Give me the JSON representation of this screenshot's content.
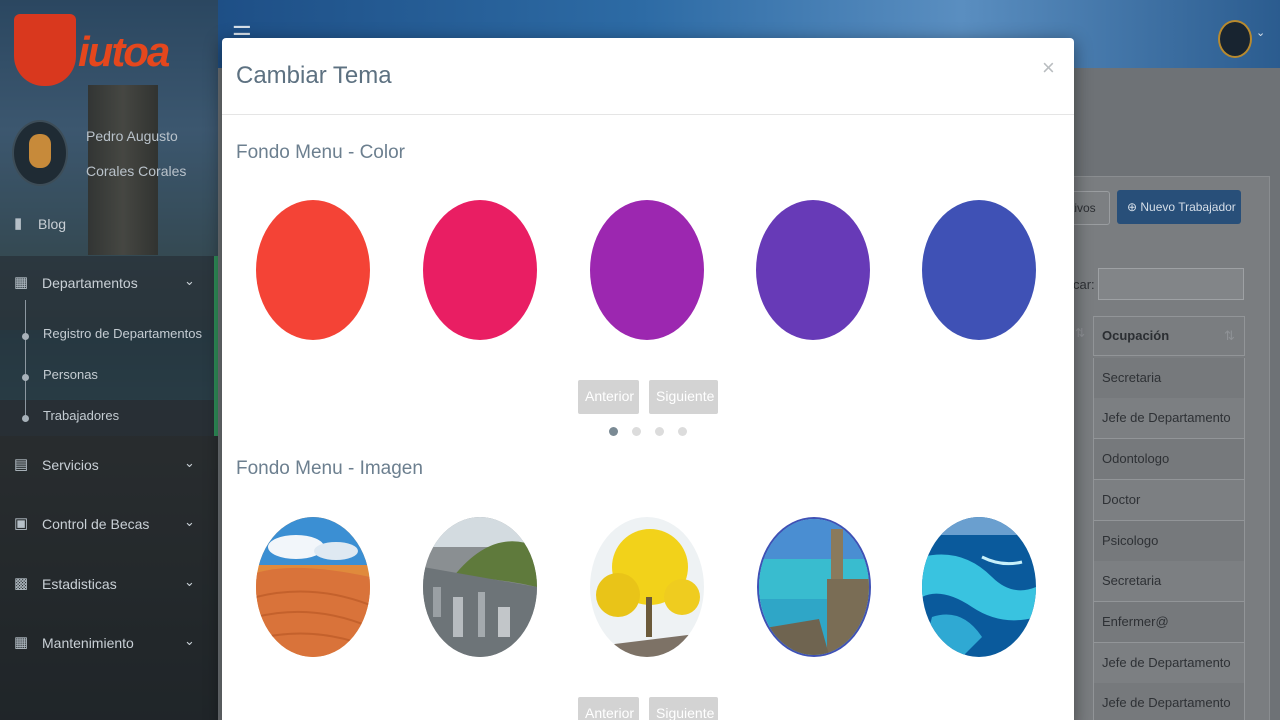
{
  "sidebar": {
    "logo_text": "iutoa",
    "user": {
      "first_line": "Pedro Augusto",
      "second_line": "Corales Corales"
    },
    "items": [
      {
        "label": "Blog",
        "icon": "book-icon"
      },
      {
        "label": "Departamentos",
        "icon": "building-icon"
      },
      {
        "label": "Servicios",
        "icon": "list-icon"
      },
      {
        "label": "Control de Becas",
        "icon": "money-icon"
      },
      {
        "label": "Estadisticas",
        "icon": "bar-chart-icon"
      },
      {
        "label": "Mantenimiento",
        "icon": "table-icon"
      }
    ],
    "subitems": [
      {
        "label": "Registro de Departamentos"
      },
      {
        "label": "Personas"
      },
      {
        "label": "Trabajadores"
      }
    ]
  },
  "main": {
    "legacy_button": "tivos",
    "new_button": "Nuevo Trabajador",
    "search_label": "car:",
    "column_header": "Ocupación",
    "rows": [
      "Secretaria",
      "Jefe de Departamento",
      "Odontologo",
      "Doctor",
      "Psicologo",
      "Secretaria",
      "Enfermer@",
      "Jefe de Departamento",
      "Jefe de Departamento"
    ]
  },
  "modal": {
    "title": "Cambiar Tema",
    "close": "×",
    "color_section": {
      "title": "Fondo Menu - Color",
      "colors": [
        "#f44336",
        "#e91e63",
        "#9c27b0",
        "#673ab7",
        "#3f51b5"
      ],
      "prev": "Anterior",
      "next": "Siguiente",
      "active_page": 1,
      "pages": 4
    },
    "image_section": {
      "title": "Fondo Menu - Imagen",
      "images": [
        "desert-dunes",
        "city-mountains",
        "yellow-tree",
        "coastal-fort",
        "coral-reef"
      ],
      "selected": 4,
      "prev": "Anterior",
      "next": "Siguiente"
    }
  }
}
